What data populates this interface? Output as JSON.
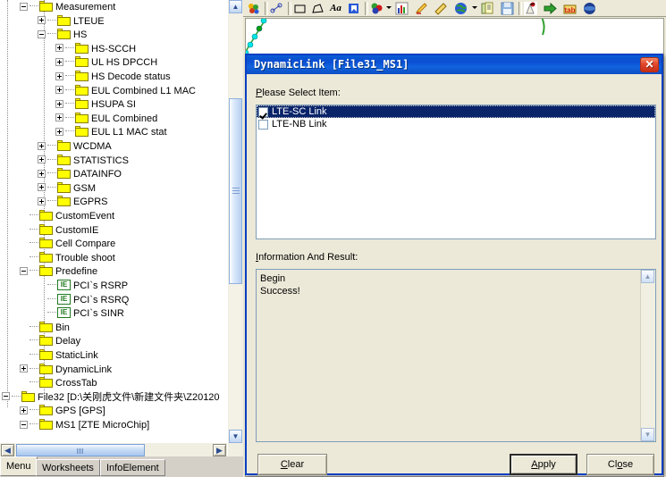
{
  "tree": {
    "rows": [
      {
        "label": "Measurement",
        "depth": 2,
        "toggle": "minus",
        "icon": "folder"
      },
      {
        "label": "LTEUE",
        "depth": 3,
        "toggle": "plus",
        "icon": "folder"
      },
      {
        "label": "HS",
        "depth": 3,
        "toggle": "minus",
        "icon": "folder"
      },
      {
        "label": "HS-SCCH",
        "depth": 4,
        "toggle": "plus",
        "icon": "folder"
      },
      {
        "label": "UL HS DPCCH",
        "depth": 4,
        "toggle": "plus",
        "icon": "folder"
      },
      {
        "label": "HS Decode status",
        "depth": 4,
        "toggle": "plus",
        "icon": "folder"
      },
      {
        "label": "EUL Combined L1 MAC",
        "depth": 4,
        "toggle": "plus",
        "icon": "folder"
      },
      {
        "label": "HSUPA SI",
        "depth": 4,
        "toggle": "plus",
        "icon": "folder"
      },
      {
        "label": "EUL Combined",
        "depth": 4,
        "toggle": "plus",
        "icon": "folder"
      },
      {
        "label": "EUL L1 MAC stat",
        "depth": 4,
        "toggle": "plus",
        "icon": "folder"
      },
      {
        "label": "WCDMA",
        "depth": 3,
        "toggle": "plus",
        "icon": "folder"
      },
      {
        "label": "STATISTICS",
        "depth": 3,
        "toggle": "plus",
        "icon": "folder"
      },
      {
        "label": "DATAINFO",
        "depth": 3,
        "toggle": "plus",
        "icon": "folder"
      },
      {
        "label": "GSM",
        "depth": 3,
        "toggle": "plus",
        "icon": "folder"
      },
      {
        "label": "EGPRS",
        "depth": 3,
        "toggle": "plus",
        "icon": "folder"
      },
      {
        "label": "CustomEvent",
        "depth": 2,
        "toggle": "none",
        "icon": "folder"
      },
      {
        "label": "CustomIE",
        "depth": 2,
        "toggle": "none",
        "icon": "folder"
      },
      {
        "label": "Cell Compare",
        "depth": 2,
        "toggle": "none",
        "icon": "folder"
      },
      {
        "label": "Trouble shoot",
        "depth": 2,
        "toggle": "none",
        "icon": "folder"
      },
      {
        "label": "Predefine",
        "depth": 2,
        "toggle": "minus",
        "icon": "folder"
      },
      {
        "label": "PCI`s RSRP",
        "depth": 3,
        "toggle": "none",
        "icon": "ie"
      },
      {
        "label": "PCI`s RSRQ",
        "depth": 3,
        "toggle": "none",
        "icon": "ie"
      },
      {
        "label": "PCI`s SINR",
        "depth": 3,
        "toggle": "none",
        "icon": "ie"
      },
      {
        "label": "Bin",
        "depth": 2,
        "toggle": "none",
        "icon": "folder"
      },
      {
        "label": "Delay",
        "depth": 2,
        "toggle": "none",
        "icon": "folder"
      },
      {
        "label": "StaticLink",
        "depth": 2,
        "toggle": "none",
        "icon": "folder"
      },
      {
        "label": "DynamicLink",
        "depth": 2,
        "toggle": "plus",
        "icon": "folder"
      },
      {
        "label": "CrossTab",
        "depth": 2,
        "toggle": "none",
        "icon": "folder"
      },
      {
        "label": "File32 [D:\\关刚虎文件\\新建文件夹\\Z20120",
        "depth": 1,
        "toggle": "minus",
        "icon": "folder"
      },
      {
        "label": "GPS [GPS]",
        "depth": 2,
        "toggle": "plus",
        "icon": "folder"
      },
      {
        "label": "MS1 [ZTE MicroChip]",
        "depth": 2,
        "toggle": "minus",
        "icon": "folder"
      }
    ],
    "ie_glyph": "IE",
    "hscroll": {
      "left_arrow": "◀",
      "right_arrow": "▶"
    },
    "vscroll": {
      "up_arrow": "▲",
      "down_arrow": "▼"
    }
  },
  "tabs": [
    {
      "label": "Menu",
      "active": true
    },
    {
      "label": "Worksheets",
      "active": false
    },
    {
      "label": "InfoElement",
      "active": false
    }
  ],
  "toolbar": {
    "items": [
      {
        "name": "legend-icon"
      },
      {
        "name": "polyline-tool-icon"
      },
      {
        "name": "rectangle-tool-icon"
      },
      {
        "name": "polygon-tool-icon"
      },
      {
        "name": "text-tool-icon"
      },
      {
        "name": "flag-marker-icon"
      },
      {
        "name": "theme-color-icon"
      },
      {
        "name": "statistics-chart-icon"
      },
      {
        "name": "highlight-pen-icon"
      },
      {
        "name": "ruler-measure-icon"
      },
      {
        "name": "globe-map-icon"
      },
      {
        "name": "report-list-icon"
      },
      {
        "name": "save-disk-icon"
      },
      {
        "name": "antenna-site-icon"
      },
      {
        "name": "green-arrow-export-icon"
      },
      {
        "name": "tab-color-icon"
      },
      {
        "name": "globe-dark-icon"
      }
    ]
  },
  "dialog": {
    "title": "DynamicLink [File31_MS1]",
    "close_glyph": "✕",
    "select_label": "Please Select Item:",
    "select_label_mnemonic": "P",
    "items": [
      {
        "label": "LTE-SC Link",
        "checked": true,
        "selected": true
      },
      {
        "label": "LTE-NB Link",
        "checked": false,
        "selected": false
      }
    ],
    "info_label": "Information And Result:",
    "info_label_mnemonic": "I",
    "info_lines": [
      "Begin",
      "Success!"
    ],
    "buttons": [
      {
        "name": "clear-button",
        "label": "Clear",
        "mnemonic": "C",
        "default": false
      },
      {
        "name": "apply-button",
        "label": "Apply",
        "mnemonic": "A",
        "default": true
      },
      {
        "name": "close-button",
        "label": "Close",
        "mnemonic": "o",
        "default": false
      }
    ],
    "scroll": {
      "up_arrow": "▲",
      "down_arrow": "▼"
    }
  },
  "colors": {
    "dialog_border": "#0a3fc4",
    "title_bar": "#0b4fd4",
    "selection": "#0a246a",
    "folder": "#ffff00",
    "panel": "#ece9d8",
    "ie_green": "#1f7a1f"
  }
}
